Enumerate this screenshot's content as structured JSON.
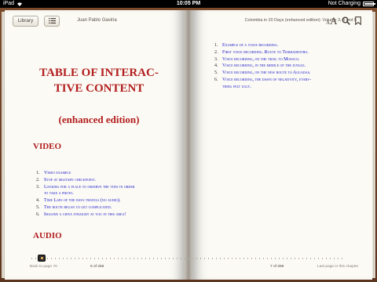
{
  "status_bar": {
    "device": "iPad",
    "time": "10:05 PM",
    "charging": "Not Charging"
  },
  "toolbar": {
    "library_label": "Library",
    "author": "Juan Pablo Gaviria",
    "book_title": "Colombia in 20 Days (enhanced edition): Volume 3, 4 and 5",
    "font_small": "A",
    "font_big": "A"
  },
  "left_page": {
    "title_line1": "TABLE OF INTERAC-",
    "title_line2": "TIVE CONTENT",
    "subtitle": "(enhanced edition)",
    "video_heading": "VIDEO",
    "video_items": [
      {
        "num": "1.",
        "text": "Video example"
      },
      {
        "num": "2.",
        "text": "Stop at military checkpoint."
      },
      {
        "num": "3.",
        "text": "Looking for a place to observe the view in order"
      },
      {
        "num": "",
        "text": "to take a photo."
      },
      {
        "num": "4.",
        "text": "Time Laps of the days travels (no audio)."
      },
      {
        "num": "5.",
        "text": "The route began to get complicated."
      },
      {
        "num": "6.",
        "text": "Imagine a chiva straight at you in this area!"
      }
    ],
    "audio_heading": "AUDIO"
  },
  "right_page": {
    "audio_items": [
      {
        "num": "1.",
        "text": "Example of a voice recording."
      },
      {
        "num": "2.",
        "text": "First voice recording. Route to Tierradentro."
      },
      {
        "num": "3.",
        "text": "Voice recording, on the trail to Mosoco."
      },
      {
        "num": "4.",
        "text": "Voice recording, in the middle of the jungle."
      },
      {
        "num": "5.",
        "text": "Voice recording, on the new route to Aguadas."
      },
      {
        "num": "6.",
        "text": "Voice recording, the dawn of negativity, every-"
      },
      {
        "num": "",
        "text": "thing felt ugly."
      }
    ]
  },
  "footer": {
    "back_label": "Back to page 70",
    "left_page_num": "6 of 266",
    "right_page_num": "7 of 266",
    "remaining": "Last page in this chapter"
  },
  "reading_progress_fraction": 0.02
}
